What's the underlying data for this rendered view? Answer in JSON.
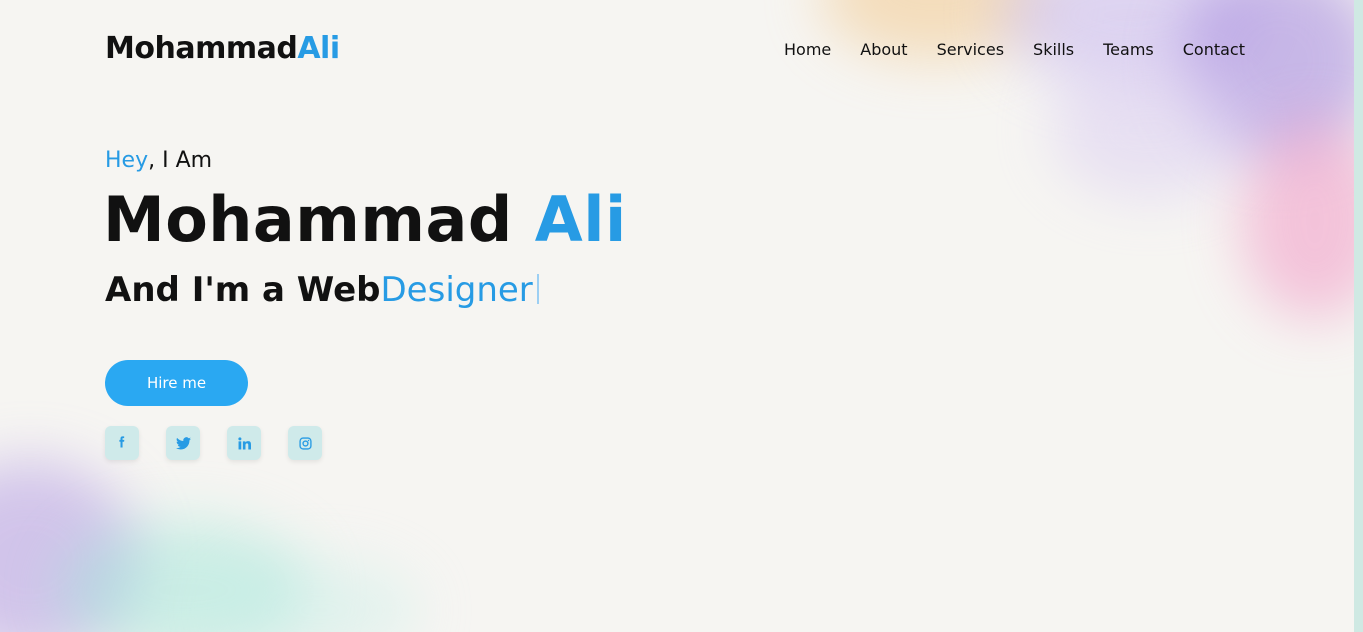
{
  "header": {
    "logo_primary": "Mohammad",
    "logo_accent": "Ali",
    "nav": [
      {
        "label": "Home"
      },
      {
        "label": "About"
      },
      {
        "label": "Services"
      },
      {
        "label": "Skills"
      },
      {
        "label": "Teams"
      },
      {
        "label": "Contact"
      }
    ]
  },
  "hero": {
    "greeting_accent": "Hey",
    "greeting_rest": ", I Am",
    "name_primary": "Mohammad",
    "name_accent": "Ali",
    "role_static": "And I'm a Web",
    "role_typed": "Designer",
    "hire_label": "Hire me",
    "socials": [
      {
        "icon": "facebook-icon"
      },
      {
        "icon": "twitter-icon"
      },
      {
        "icon": "linkedin-icon"
      },
      {
        "icon": "instagram-icon"
      }
    ]
  },
  "colors": {
    "accent": "#279be4",
    "button": "#2aa8f2",
    "social_bg": "#cfeaea",
    "background": "#f6f5f2"
  }
}
